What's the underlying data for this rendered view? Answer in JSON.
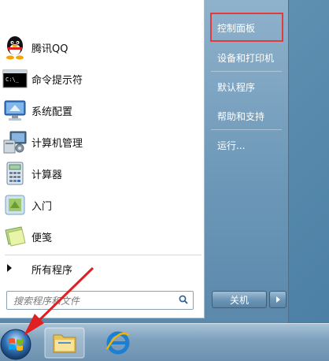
{
  "programs": [
    {
      "label": "腾讯QQ",
      "icon": "qq-icon"
    },
    {
      "label": "命令提示符",
      "icon": "command-prompt-icon"
    },
    {
      "label": "系统配置",
      "icon": "system-config-icon"
    },
    {
      "label": "计算机管理",
      "icon": "computer-management-icon"
    },
    {
      "label": "计算器",
      "icon": "calculator-icon"
    },
    {
      "label": "入门",
      "icon": "getting-started-icon"
    },
    {
      "label": "便笺",
      "icon": "sticky-notes-icon"
    }
  ],
  "all_programs_label": "所有程序",
  "search": {
    "placeholder": "搜索程序和文件"
  },
  "right_pane": {
    "items": [
      "控制面板",
      "设备和打印机",
      "默认程序",
      "帮助和支持",
      "运行..."
    ]
  },
  "shutdown_label": "关机",
  "colors": {
    "highlight": "#e53a3a",
    "annotation_arrow": "#e02020"
  }
}
